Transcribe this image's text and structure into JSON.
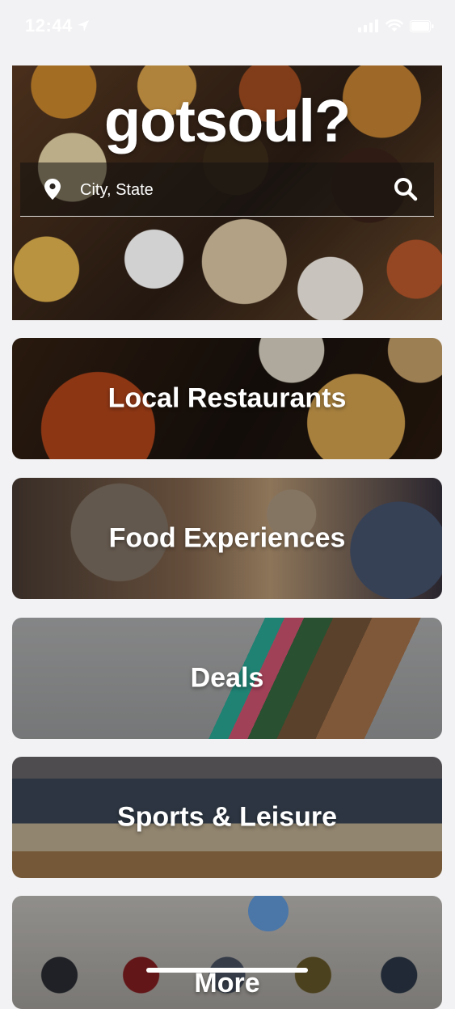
{
  "status_bar": {
    "time": "12:44"
  },
  "hero": {
    "title": "gotsoul?",
    "search": {
      "placeholder": "City, State"
    }
  },
  "categories": [
    {
      "label": "Local Restaurants"
    },
    {
      "label": "Food Experiences"
    },
    {
      "label": "Deals"
    },
    {
      "label": "Sports & Leisure"
    },
    {
      "label": "More"
    }
  ],
  "icons": {
    "location": "map-pin-icon",
    "search": "search-icon",
    "location_services": "location-arrow-icon",
    "signal": "cellular-signal-icon",
    "wifi": "wifi-icon",
    "battery": "battery-icon"
  }
}
